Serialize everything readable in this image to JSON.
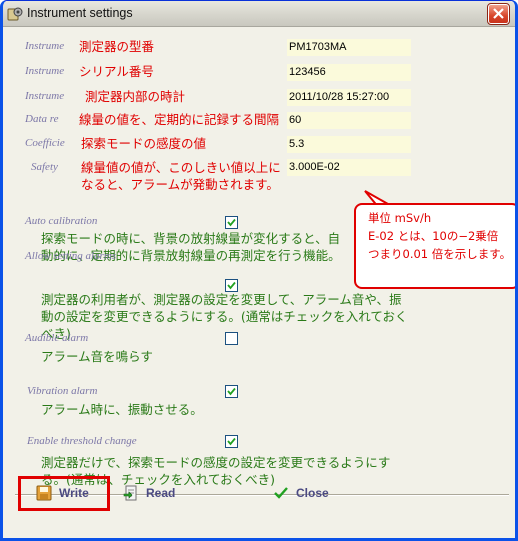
{
  "window": {
    "title": "Instrument settings"
  },
  "fields": [
    {
      "label": "Instrume",
      "note": "測定器の型番",
      "value": "PM1703MA"
    },
    {
      "label": "Instrume",
      "note": "シリアル番号",
      "value": "123456"
    },
    {
      "label": "Instrume",
      "note": "測定器内部の時計",
      "value": "2011/10/28 15:27:00"
    },
    {
      "label": "Data re",
      "note": "線量の値を、定期的に記録する間隔",
      "value": "60"
    },
    {
      "label": "Coefficie",
      "note": "探索モードの感度の値",
      "value": "5.3"
    },
    {
      "label": "Safety",
      "note": "線量値の値が、このしきい値以上になると、アラームが発動されます。",
      "value": "3.000E-02"
    }
  ],
  "callout": {
    "line1": "単位 mSv/h",
    "line2": "E-02 とは、10の−2乗倍",
    "line3": "つまり0.01 倍を示します。"
  },
  "options": [
    {
      "label": "Auto calibration",
      "checked": true,
      "desc": "探索モードの時に、背景の放射線量が変化すると、自動的に、定期的に背景放射線量の再測定を行う機能。"
    },
    {
      "label": "Allow setting alarms",
      "checked": true,
      "desc": "測定器の利用者が、測定器の設定を変更して、アラーム音や、振動の設定を変更できるようにする。(通常はチェックを入れておくべき)"
    },
    {
      "label": "Audible alarm",
      "checked": false,
      "desc": "アラーム音を鳴らす"
    },
    {
      "label": "Vibration alarm",
      "checked": true,
      "desc": "アラーム時に、振動させる。"
    },
    {
      "label": "Enable threshold change",
      "checked": true,
      "desc": "測定器だけで、探索モードの感度の設定を変更できるようにする。(通常は、チェックを入れておくべき)"
    }
  ],
  "buttons": {
    "write": "Write",
    "read": "Read",
    "close": "Close"
  },
  "colors": {
    "annotation_red": "#e00000",
    "annotation_green": "#2a7a18",
    "label_purple": "#7d78a8",
    "field_bg": "#fbfadb"
  }
}
